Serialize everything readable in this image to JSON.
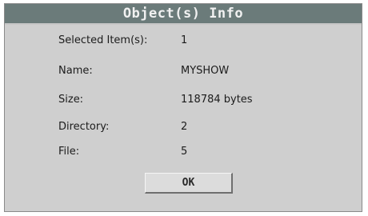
{
  "dialog": {
    "title": "Object(s) Info",
    "rows": [
      {
        "label": "Selected Item(s):",
        "value": "1"
      },
      {
        "label": "Name:",
        "value": "MYSHOW"
      },
      {
        "label": "Size:",
        "value": "118784 bytes"
      },
      {
        "label": "Directory:",
        "value": "2"
      },
      {
        "label": "File:",
        "value": "5"
      }
    ],
    "ok_label": "OK"
  }
}
